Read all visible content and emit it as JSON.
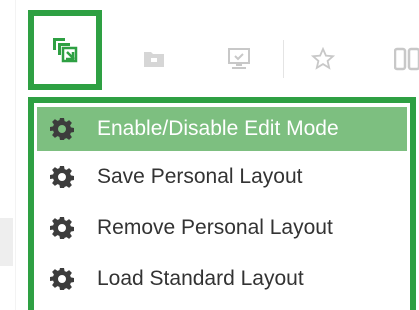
{
  "toolbar": {
    "active_button_icon": "layout-copy-icon",
    "icons": [
      "folder-icon",
      "monitor-icon",
      "star-icon",
      "columns-icon"
    ]
  },
  "menu": {
    "items": [
      {
        "label": "Enable/Disable Edit Mode",
        "icon": "gear-icon",
        "selected": true
      },
      {
        "label": "Save Personal Layout",
        "icon": "gear-icon",
        "selected": false
      },
      {
        "label": "Remove Personal Layout",
        "icon": "gear-icon",
        "selected": false
      },
      {
        "label": "Load Standard Layout",
        "icon": "gear-icon",
        "selected": false
      }
    ]
  },
  "colors": {
    "accent": "#2ea043",
    "selected_bg": "#7dbf80",
    "icon_gray": "#c8c8c8",
    "text": "#333333"
  }
}
